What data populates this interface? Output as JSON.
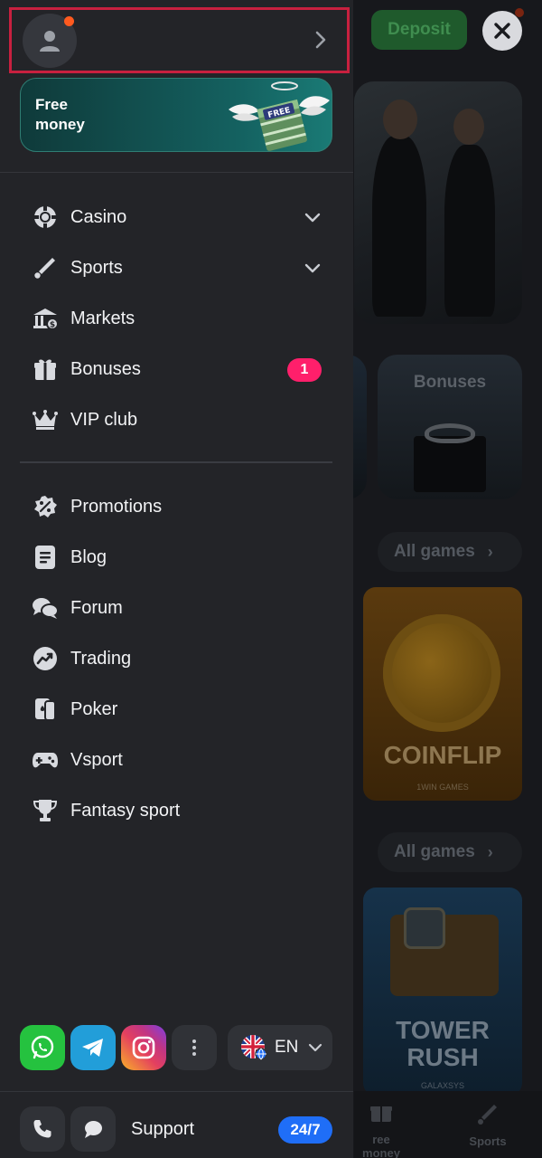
{
  "background": {
    "deposit_label": "Deposit",
    "bonuses_card_label": "Bonuses",
    "all_games_label_1": "All games",
    "all_games_label_2": "All games",
    "game_1": {
      "title": "COINFLIP",
      "provider": "1WIN GAMES"
    },
    "game_2": {
      "title_line1": "TOWER",
      "title_line2": "RUSH",
      "provider": "GALAXSYS"
    },
    "bottom_nav": {
      "free_money": "ree money",
      "sports": "Sports"
    }
  },
  "drawer": {
    "promo": {
      "label": "Free money",
      "ribbon": "FREE"
    },
    "main_menu": [
      {
        "label": "Casino",
        "icon": "casino-chip-icon",
        "expandable": true
      },
      {
        "label": "Sports",
        "icon": "sports-icon",
        "expandable": true
      },
      {
        "label": "Markets",
        "icon": "markets-icon"
      },
      {
        "label": "Bonuses",
        "icon": "gift-icon",
        "badge": "1"
      },
      {
        "label": "VIP club",
        "icon": "crown-icon"
      }
    ],
    "secondary_menu": [
      {
        "label": "Promotions",
        "icon": "percent-badge-icon"
      },
      {
        "label": "Blog",
        "icon": "document-icon"
      },
      {
        "label": "Forum",
        "icon": "chat-bubbles-icon"
      },
      {
        "label": "Trading",
        "icon": "trending-icon"
      },
      {
        "label": "Poker",
        "icon": "cards-icon"
      },
      {
        "label": "Vsport",
        "icon": "gamepad-icon"
      },
      {
        "label": "Fantasy sport",
        "icon": "trophy-icon"
      }
    ],
    "language": {
      "code": "EN"
    },
    "support": {
      "label": "Support",
      "hours": "24/7"
    }
  },
  "colors": {
    "drawer_bg": "#232428",
    "accent_badge": "#ff1f6b",
    "support_pill": "#1f6ef7",
    "highlight_border": "#c8203f"
  }
}
